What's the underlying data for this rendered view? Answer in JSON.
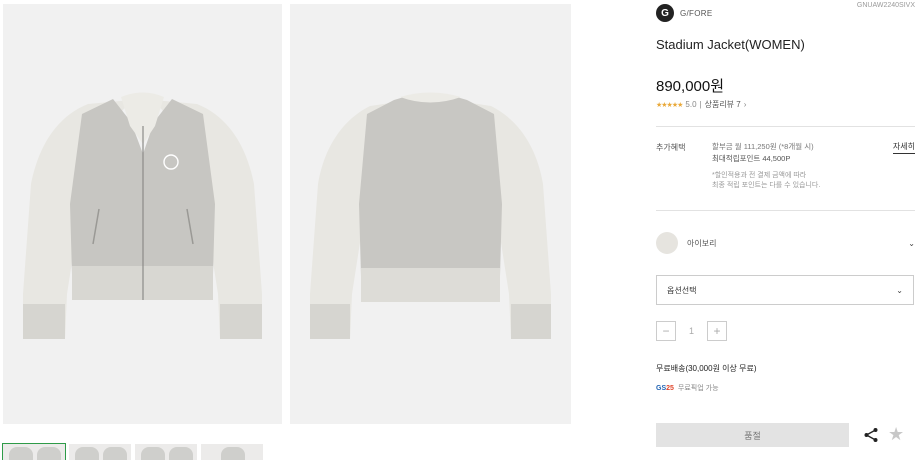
{
  "product": {
    "brand": "G/FORE",
    "code": "GNUAW2240SIVX",
    "title": "Stadium Jacket(WOMEN)",
    "price": "890,000원",
    "rating": {
      "stars": "★★★★★",
      "score": "5.0",
      "separator": "|",
      "review_label": "상품리뷰 7",
      "review_arrow": "›"
    }
  },
  "benefits": {
    "label": "추가혜택",
    "installment": "할부금 월 111,250원 (*8개월 시)",
    "points": "최대적립포인트 44,500P",
    "note_line1": "*할인적용과 전 결제 금액에 따라",
    "note_line2": "최종 적립 포인트는 다를 수 있습니다.",
    "detail_link": "자세히"
  },
  "color_option": {
    "name": "아이보리",
    "swatch": "#e6e4df",
    "chevron": "⌄"
  },
  "option_select": {
    "value": "옵션선택",
    "chevron": "⌄"
  },
  "quantity": {
    "minus": "−",
    "value": "1",
    "plus": "+"
  },
  "shipping": {
    "text": "무료배송(30,000원 이상 무료)",
    "gs_logo": "GS25",
    "gs_text": "무료픽업 가능"
  },
  "actions": {
    "soldout_label": "품절",
    "favorite_icon": "★",
    "share_icon": "share-icon"
  },
  "gallery": {
    "images": [
      "jacket-front",
      "jacket-back"
    ],
    "thumbnail_count": 4
  },
  "colors": {
    "jacket_body": "#c9c8c4",
    "jacket_sleeve": "#e9e8e3",
    "rating_star": "#e9a93a"
  }
}
